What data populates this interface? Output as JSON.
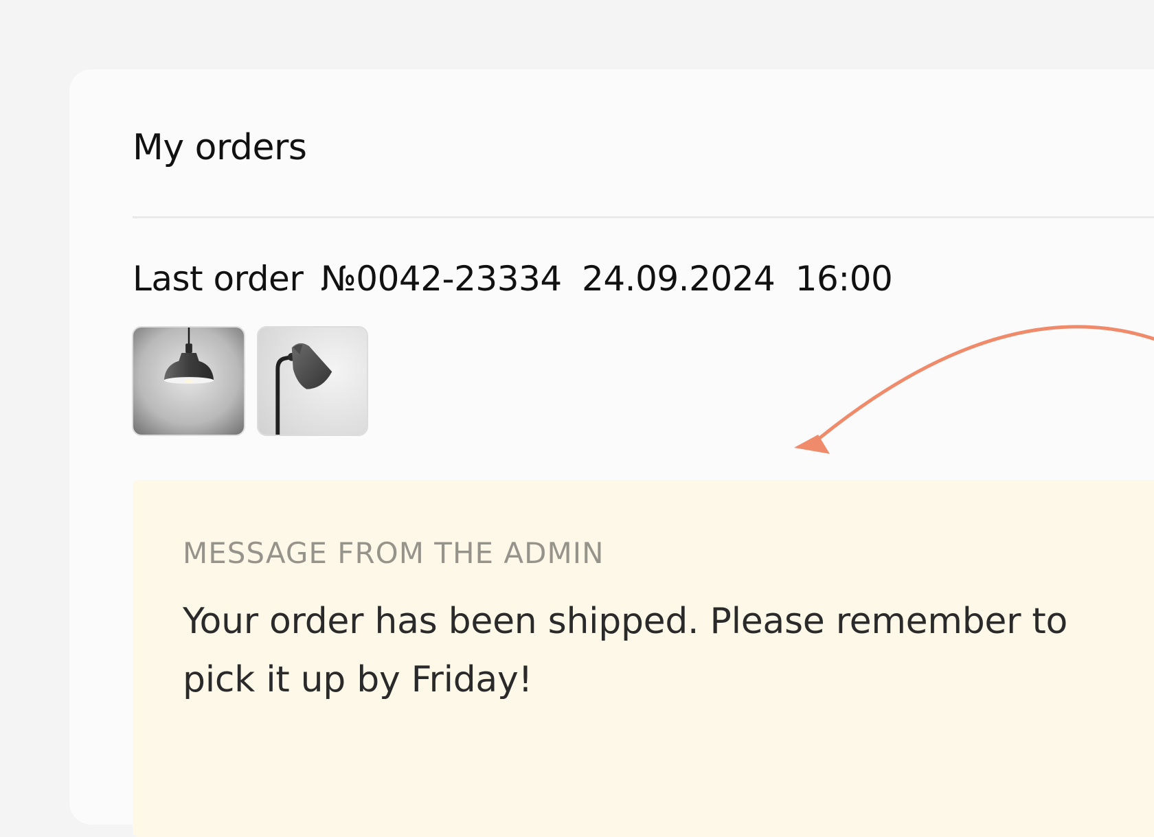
{
  "page": {
    "title": "My orders"
  },
  "last_order": {
    "label": "Last order",
    "number": "№0042-23334",
    "date": "24.09.2024",
    "time": "16:00",
    "items": [
      {
        "icon": "pendant-lamp-icon"
      },
      {
        "icon": "floor-lamp-icon"
      }
    ]
  },
  "admin_message": {
    "label": "MESSAGE FROM THE ADMIN",
    "text": "Your order has been shipped. Please remember to pick it up by Friday!"
  },
  "colors": {
    "page_background": "#f4f4f4",
    "card_background": "#fbfbfb",
    "message_background": "#fdf8e7",
    "arrow": "#ef8a6b",
    "label_gray": "#96938b"
  }
}
